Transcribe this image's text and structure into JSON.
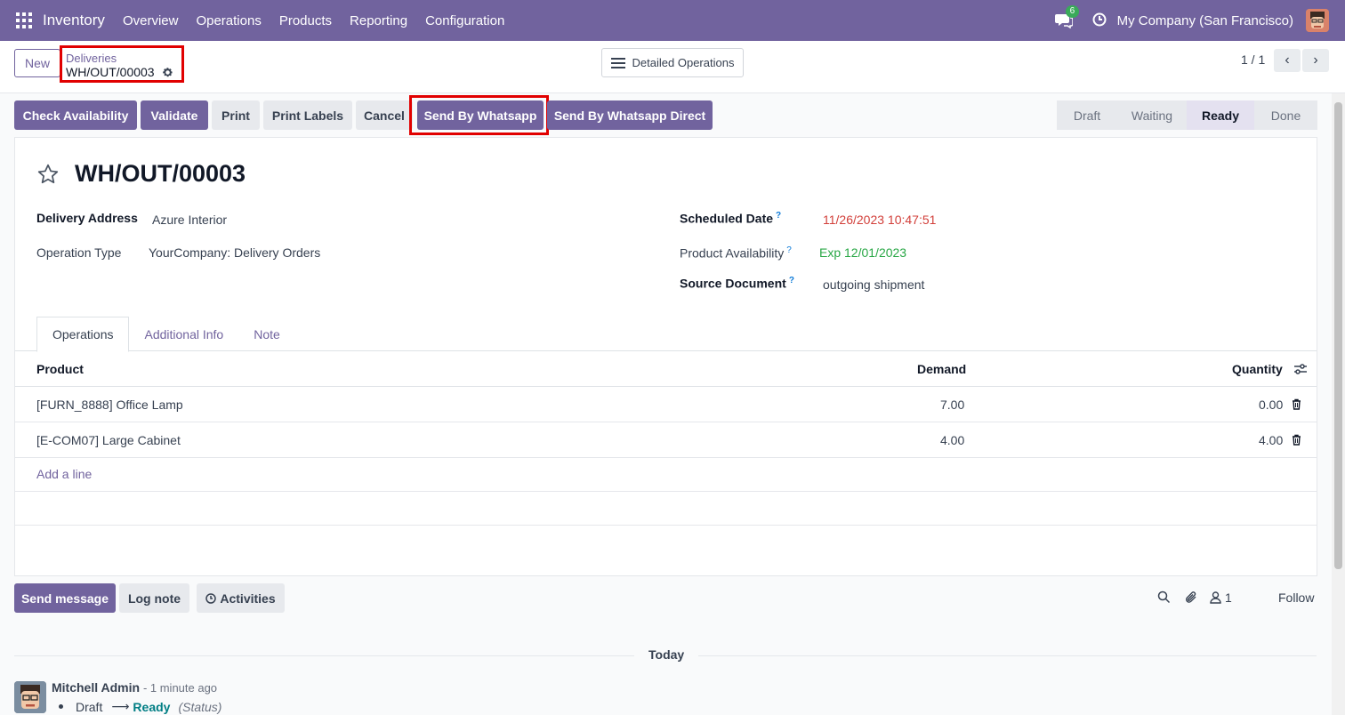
{
  "navbar": {
    "app_name": "Inventory",
    "menu": [
      "Overview",
      "Operations",
      "Products",
      "Reporting",
      "Configuration"
    ],
    "chat_badge": "6",
    "company": "My Company (San Francisco)"
  },
  "control_panel": {
    "new_label": "New",
    "breadcrumb_parent": "Deliveries",
    "breadcrumb_current": "WH/OUT/00003",
    "detailed_operations_label": "Detailed Operations",
    "pager": "1 / 1"
  },
  "actions": {
    "check_availability": "Check Availability",
    "validate": "Validate",
    "print": "Print",
    "print_labels": "Print Labels",
    "cancel": "Cancel",
    "send_whatsapp": "Send By Whatsapp",
    "send_whatsapp_direct": "Send By Whatsapp Direct"
  },
  "statusbar": [
    "Draft",
    "Waiting",
    "Ready",
    "Done"
  ],
  "status_current": "Ready",
  "form": {
    "title": "WH/OUT/00003",
    "delivery_address_label": "Delivery Address",
    "delivery_address": "Azure Interior",
    "operation_type_label": "Operation Type",
    "operation_type": "YourCompany: Delivery Orders",
    "scheduled_date_label": "Scheduled Date",
    "scheduled_date": "11/26/2023 10:47:51",
    "product_availability_label": "Product Availability",
    "product_availability": "Exp 12/01/2023",
    "source_document_label": "Source Document",
    "source_document": "outgoing shipment",
    "help_mark": "?"
  },
  "tabs": [
    "Operations",
    "Additional Info",
    "Note"
  ],
  "table": {
    "headers": {
      "product": "Product",
      "demand": "Demand",
      "quantity": "Quantity"
    },
    "rows": [
      {
        "product": "[FURN_8888] Office Lamp",
        "demand": "7.00",
        "quantity": "0.00"
      },
      {
        "product": "[E-COM07] Large Cabinet",
        "demand": "4.00",
        "quantity": "4.00"
      }
    ],
    "add_line": "Add a line"
  },
  "chatter": {
    "send_message": "Send message",
    "log_note": "Log note",
    "activities": "Activities",
    "followers_count": "1",
    "follow": "Follow",
    "today": "Today",
    "message": {
      "author": "Mitchell Admin",
      "ago": "- 1 minute ago",
      "old_value": "Draft",
      "arrow": "⟶",
      "new_value": "Ready",
      "field": "(Status)"
    }
  },
  "colors": {
    "brand": "#71639e",
    "highlight": "#e10000",
    "date_overdue": "#d23f3a",
    "availability_ok": "#28a745"
  }
}
